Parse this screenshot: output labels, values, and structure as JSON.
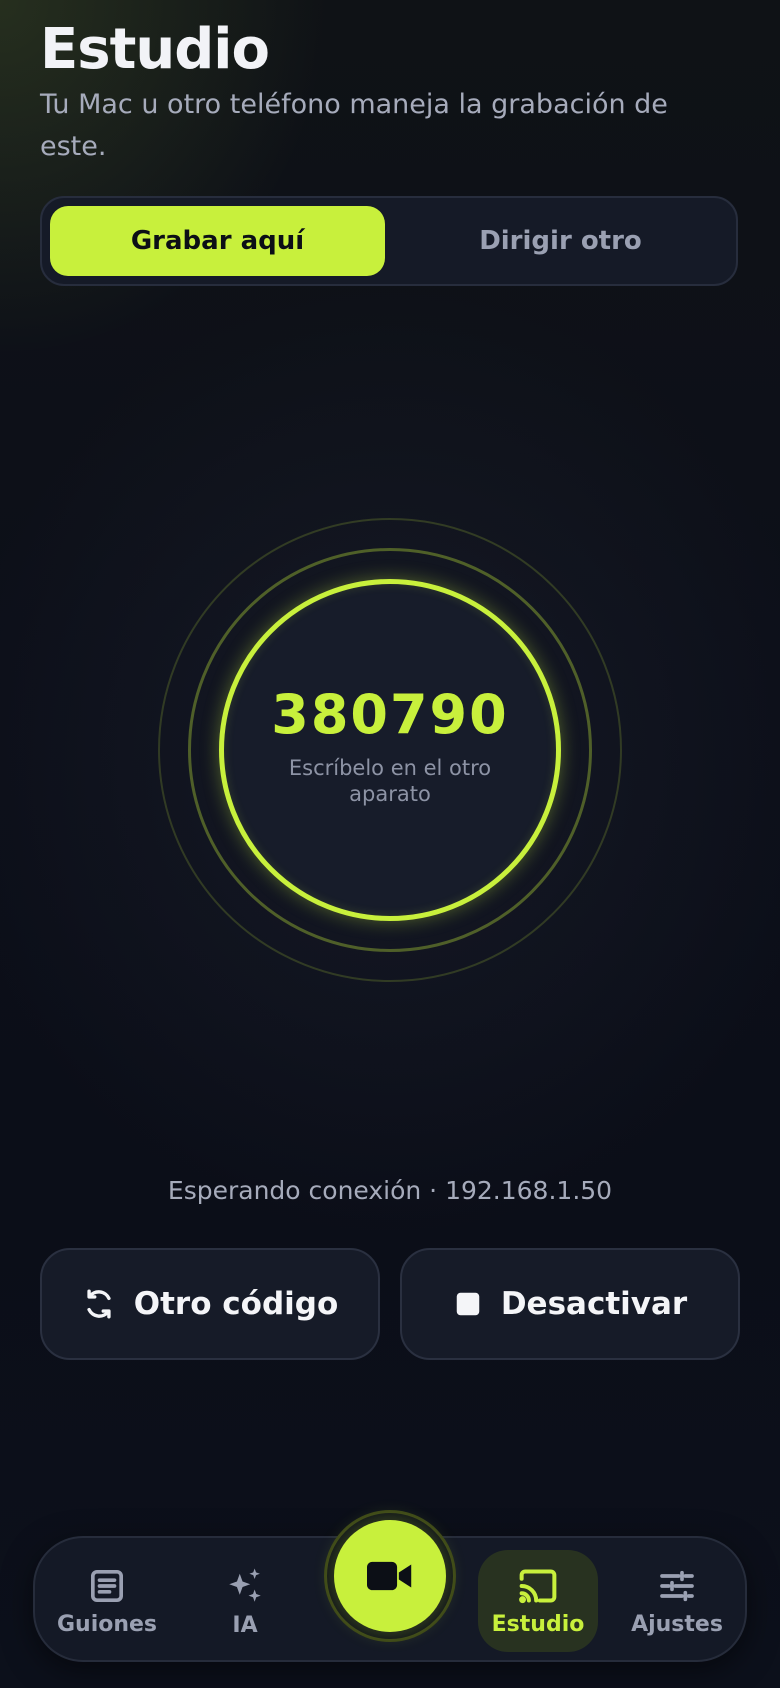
{
  "header": {
    "title": "Estudio",
    "subtitle": "Tu Mac u otro teléfono maneja la grabación de este."
  },
  "mode_toggle": {
    "options": [
      {
        "label": "Grabar aquí",
        "active": true
      },
      {
        "label": "Dirigir otro",
        "active": false
      }
    ]
  },
  "pairing": {
    "code": "380790",
    "hint": "Escríbelo en el otro aparato"
  },
  "status": {
    "text": "Esperando conexión · 192.168.1.50"
  },
  "actions": {
    "regenerate_label": "Otro código",
    "regenerate_icon": "refresh-icon",
    "deactivate_label": "Desactivar",
    "deactivate_icon": "stop-icon"
  },
  "nav": {
    "items": [
      {
        "label": "Guiones",
        "icon": "document-icon",
        "active": false
      },
      {
        "label": "IA",
        "icon": "sparkles-icon",
        "active": false
      },
      {
        "label": "Estudio",
        "icon": "cast-icon",
        "active": true
      },
      {
        "label": "Ajustes",
        "icon": "sliders-icon",
        "active": false
      }
    ],
    "record_icon": "video-camera-icon"
  },
  "colors": {
    "accent": "#c8f03c",
    "background": "#0b0e18",
    "surface": "#161b28",
    "muted_text": "#a6abbb"
  }
}
